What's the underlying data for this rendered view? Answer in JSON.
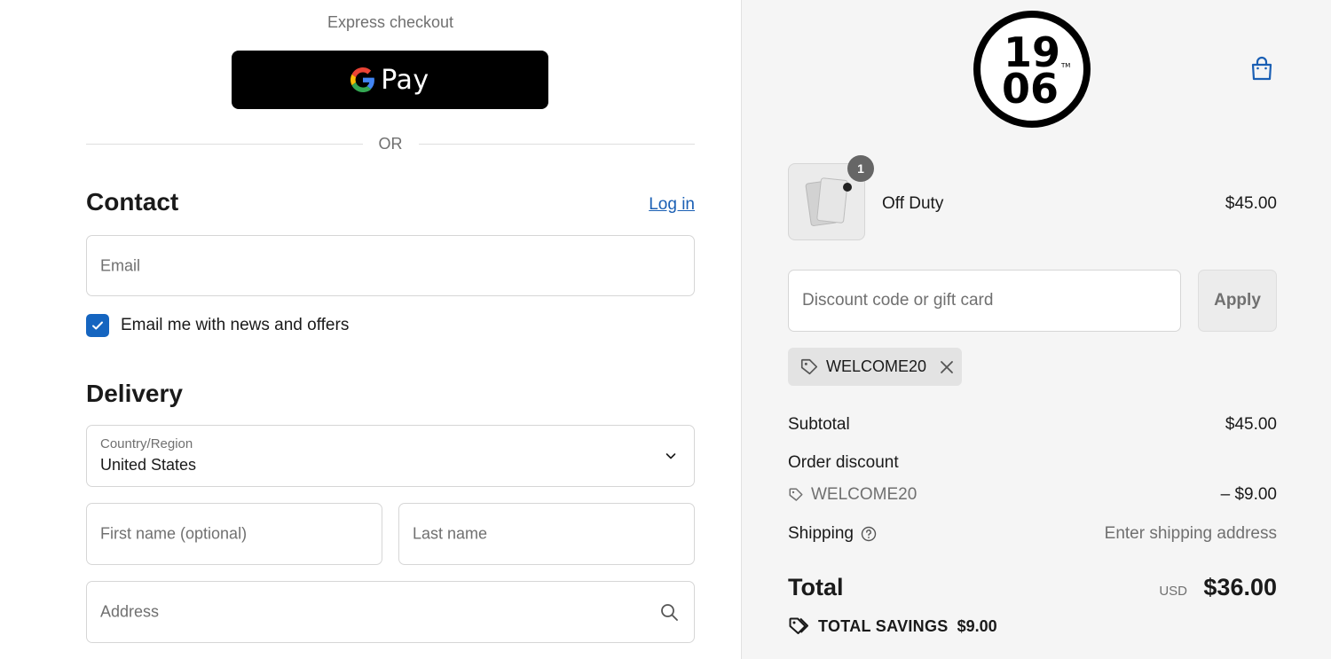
{
  "express": {
    "label": "Express checkout",
    "gpay_label": "Pay"
  },
  "divider": {
    "or": "OR"
  },
  "contact": {
    "title": "Contact",
    "login": "Log in",
    "email_placeholder": "Email",
    "newsletter_label": "Email me with news and offers",
    "newsletter_checked": true
  },
  "delivery": {
    "title": "Delivery",
    "country_label": "Country/Region",
    "country_value": "United States",
    "first_name_placeholder": "First name (optional)",
    "last_name_placeholder": "Last name",
    "address_placeholder": "Address"
  },
  "brand": {
    "logo_top": "19",
    "logo_bottom": "06",
    "logo_mark": "TM"
  },
  "cart": {
    "item_name": "Off Duty",
    "item_price": "$45.00",
    "item_quantity": "1",
    "discount_placeholder": "Discount code or gift card",
    "apply_label": "Apply",
    "applied_code": "WELCOME20"
  },
  "summary": {
    "subtotal_label": "Subtotal",
    "subtotal_value": "$45.00",
    "order_discount_label": "Order discount",
    "discount_code": "WELCOME20",
    "discount_value": "– $9.00",
    "shipping_label": "Shipping",
    "shipping_value": "Enter shipping address",
    "total_label": "Total",
    "total_currency": "USD",
    "total_value": "$36.00",
    "savings_label": "TOTAL SAVINGS",
    "savings_value": "$9.00"
  },
  "colors": {
    "accent": "#1565c0",
    "link": "#1a5fb4",
    "panel_bg": "#f5f5f5"
  }
}
